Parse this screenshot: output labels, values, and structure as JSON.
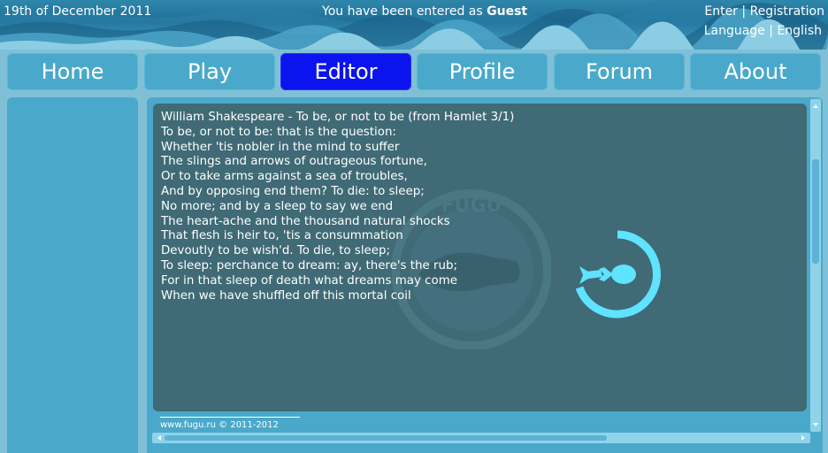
{
  "header": {
    "date": "19th of December 2011",
    "user_prefix": "You have been entered as ",
    "user_name": "Guest",
    "enter_label": "Enter",
    "registration_label": "Registration",
    "language_label": "Language",
    "english_label": "English",
    "separator": "|"
  },
  "nav": {
    "items": [
      {
        "label": "Home"
      },
      {
        "label": "Play"
      },
      {
        "label": "Editor"
      },
      {
        "label": "Profile"
      },
      {
        "label": "Forum"
      },
      {
        "label": "About"
      }
    ],
    "active": "Editor"
  },
  "editor": {
    "lines": [
      "William Shakespeare - To be, or not to be (from Hamlet 3/1)",
      "To be, or not to be: that is the question:",
      "Whether 'tis nobler in the mind to suffer",
      "The slings and arrows of outrageous fortune,",
      "Or to take arms against a sea of troubles,",
      "And by opposing end them? To die: to sleep;",
      "No more; and by a sleep to say we end",
      "The heart-ache and the thousand natural shocks",
      "That flesh is heir to, 'tis a consummation",
      "Devoutly to be wish'd. To die, to sleep;",
      "To sleep: perchance to dream: ay, there's the rub;",
      "For in that sleep of death what dreams may come",
      "When we have shuffled off this mortal coil"
    ],
    "watermark_text": "FUGU"
  },
  "footer": {
    "text": "www.fugu.ru © 2011-2012"
  },
  "colors": {
    "panel": "#4aa9cb",
    "editor_bg": "#3f6a76",
    "active_tab": "#0b14ee",
    "accent": "#5fe3ff"
  },
  "icons": {
    "spinner": "fugu-loading-icon",
    "watermark": "fugu-logo-icon"
  }
}
